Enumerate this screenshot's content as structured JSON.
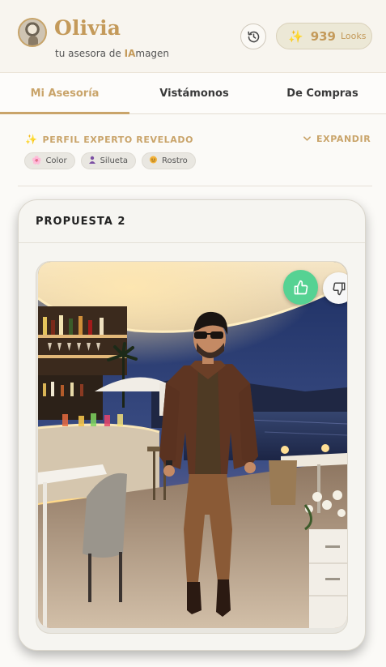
{
  "header": {
    "user_name": "Olivia",
    "subtitle_prefix": "tu asesora de ",
    "subtitle_accent": "IA",
    "subtitle_suffix": "magen",
    "looks_count": "939",
    "looks_label": "Looks",
    "icons": {
      "avatar": "user-avatar",
      "history": "history-icon",
      "sparkle": "sparkle-icon"
    }
  },
  "tabs": [
    {
      "label": "Mi Asesoría",
      "active": true
    },
    {
      "label": "Vistámonos",
      "active": false
    },
    {
      "label": "De Compras",
      "active": false
    }
  ],
  "profile": {
    "title": "PERFIL EXPERTO REVELADO",
    "expand_label": "EXPANDIR",
    "chips": [
      {
        "label": "Color",
        "icon": "palette-icon"
      },
      {
        "label": "Silueta",
        "icon": "silhouette-icon"
      },
      {
        "label": "Rostro",
        "icon": "face-icon"
      }
    ]
  },
  "proposal": {
    "title": "PROPUESTA 2",
    "photo_icon": "outfit-photo",
    "actions": {
      "like": "thumbs-up-icon",
      "dislike": "thumbs-down-icon"
    }
  },
  "colors": {
    "accent_gold": "#c9a46a",
    "brand_gold": "#c49a5a",
    "like_green": "#56d293",
    "sparkle_yellow": "#e3a72f"
  }
}
